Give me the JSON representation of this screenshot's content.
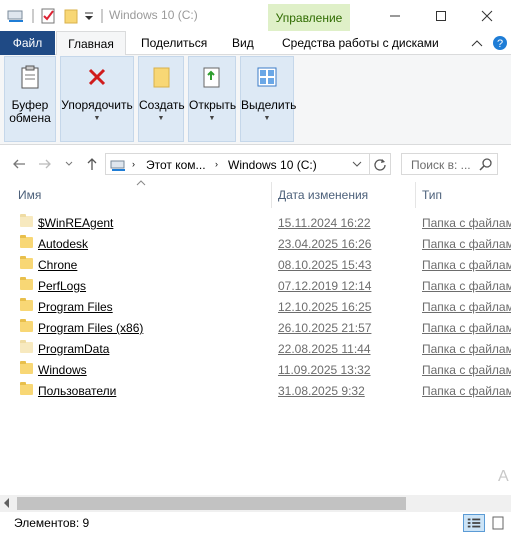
{
  "window": {
    "title": "Windows 10 (C:)",
    "context_tab": "Управление"
  },
  "ribbon_tabs": {
    "file": "Файл",
    "home": "Главная",
    "share": "Поделиться",
    "view": "Вид",
    "drive_tools": "Средства работы с дисками"
  },
  "ribbon_groups": {
    "clipboard": "Буфер обмена",
    "organize": "Упорядочить",
    "new": "Создать",
    "open": "Открыть",
    "select": "Выделить"
  },
  "address": {
    "crumb_root": "Этот ком...",
    "crumb_current": "Windows 10 (C:)",
    "search_placeholder": "Поиск в: ..."
  },
  "columns": {
    "name": "Имя",
    "date": "Дата изменения",
    "type": "Тип"
  },
  "files": [
    {
      "name": "$WinREAgent",
      "date": "15.11.2024 16:22",
      "type": "Папка с файлами",
      "faded": true
    },
    {
      "name": "Autodesk",
      "date": "23.04.2025 16:26",
      "type": "Папка с файлами",
      "faded": false
    },
    {
      "name": "Chrone",
      "date": "08.10.2025 15:43",
      "type": "Папка с файлами",
      "faded": false
    },
    {
      "name": "PerfLogs",
      "date": "07.12.2019 12:14",
      "type": "Папка с файлами",
      "faded": false
    },
    {
      "name": "Program Files",
      "date": "12.10.2025 16:25",
      "type": "Папка с файлами",
      "faded": false
    },
    {
      "name": "Program Files (x86)",
      "date": "26.10.2025 21:57",
      "type": "Папка с файлами",
      "faded": false
    },
    {
      "name": "ProgramData",
      "date": "22.08.2025 11:44",
      "type": "Папка с файлами",
      "faded": true
    },
    {
      "name": "Windows",
      "date": "11.09.2025 13:32",
      "type": "Папка с файлами",
      "faded": false
    },
    {
      "name": "Пользователи",
      "date": "31.08.2025 9:32",
      "type": "Папка с файлами",
      "faded": false
    }
  ],
  "status": {
    "items_count": "Элементов: 9"
  },
  "colors": {
    "file_tab": "#1f4a85",
    "context_tab_bg": "#dff0c8",
    "ribbon_group_bg": "#dde9f5",
    "folder": "#f8d775"
  }
}
